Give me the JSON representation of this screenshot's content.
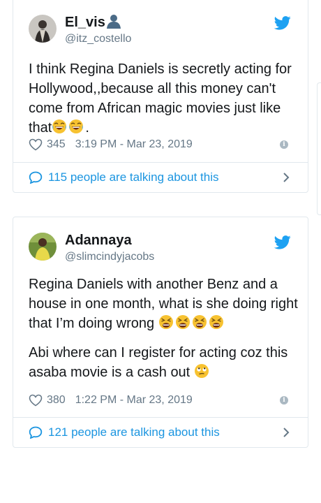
{
  "tweets": [
    {
      "name": "El_vis",
      "handle": "@itz_costello",
      "text_parts": [
        "I think Regina Daniels is secretly acting for Hollywood,,because all this money can't come from African magic movies just like that",
        "."
      ],
      "likes": "345",
      "timestamp": "3:19 PM - Mar 23, 2019",
      "talking": "115 people are talking about this",
      "icons": [
        "avatar",
        "person-silhouette-emoji",
        "twitter-bird-icon",
        "heart-icon",
        "info-icon",
        "comment-bubble-icon",
        "chevron-right-icon"
      ]
    },
    {
      "name": "Adannaya",
      "handle": "@slimcindyjacobs",
      "paragraph1": "Regina Daniels with another Benz and a house in one month, what is she doing right that I’m doing wrong",
      "paragraph2": "Abi where can I register for acting coz this asaba movie is a cash out",
      "likes": "380",
      "timestamp": "1:22 PM - Mar 23, 2019",
      "talking": "121 people are talking about this",
      "icons": [
        "avatar",
        "twitter-bird-icon",
        "weary-face-emoji",
        "face-with-rolling-eyes-emoji",
        "heart-icon",
        "info-icon",
        "comment-bubble-icon",
        "chevron-right-icon"
      ]
    }
  ],
  "colors": {
    "link": "#1b95e0",
    "secondary_text": "#657786",
    "border": "#e1e8ed",
    "twitter_blue": "#1da1f2"
  }
}
